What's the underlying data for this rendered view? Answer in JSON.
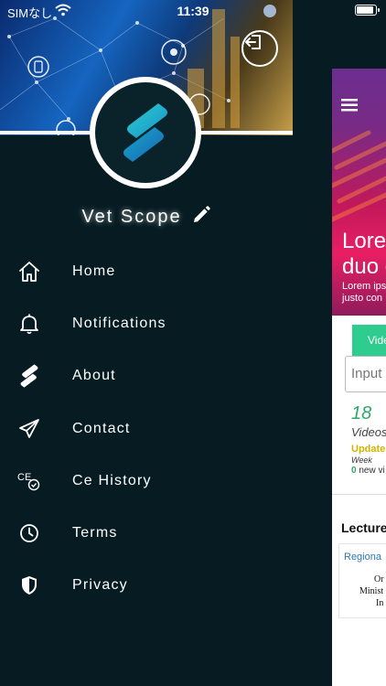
{
  "status_bar": {
    "carrier": "SIMなし",
    "time": "11:39"
  },
  "drawer": {
    "user_name": "Vet Scope",
    "menu": [
      {
        "label": "Home",
        "icon": "home-icon"
      },
      {
        "label": "Notifications",
        "icon": "bell-icon"
      },
      {
        "label": "About",
        "icon": "app-logo-icon"
      },
      {
        "label": "Contact",
        "icon": "paper-plane-icon"
      },
      {
        "label": "Ce History",
        "icon": "ce-history-icon"
      },
      {
        "label": "Terms",
        "icon": "clock-icon"
      },
      {
        "label": "Privacy",
        "icon": "shield-icon"
      }
    ]
  },
  "background_screen": {
    "hero_title_line1": "Lorem",
    "hero_title_line2": "duo e",
    "hero_sub_line1": "Lorem ips",
    "hero_sub_line2": "justo con",
    "tab_label": "Vide",
    "input_placeholder": "Input k",
    "stat_value": "18",
    "stat_label": "Videos",
    "update_label": "Update",
    "week_label": "Week",
    "new_videos_count": "0",
    "new_videos_label": "new vi",
    "section_title": "Lecture",
    "card_title": "Regiona",
    "card_line1": "Or",
    "card_line2": "Minist",
    "card_line3": "In"
  },
  "colors": {
    "drawer_bg": "#061c22",
    "accent_green": "#2ecc8f",
    "logo_teal": "#1fb3c4"
  }
}
